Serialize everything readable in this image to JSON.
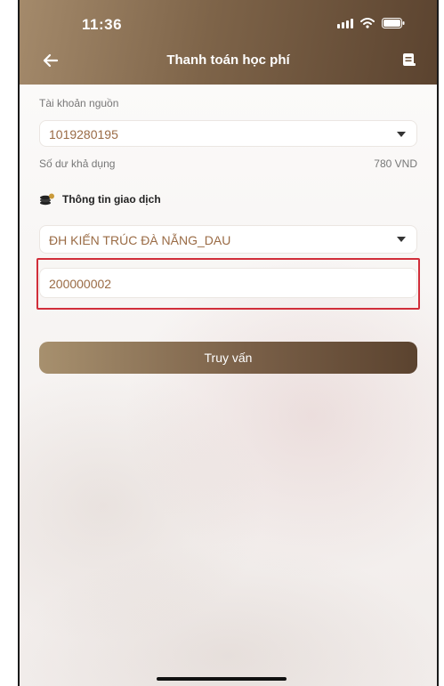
{
  "status_bar": {
    "time": "11:36",
    "signal_icon": "signal-icon",
    "wifi_icon": "wifi-icon",
    "battery_icon": "battery-icon"
  },
  "nav": {
    "title": "Thanh toán học phí",
    "back_icon": "back-arrow-icon",
    "menu_icon": "receipt-icon"
  },
  "source_account": {
    "label": "Tài khoản nguồn",
    "value": "1019280195",
    "dropdown_icon": "caret-down-icon"
  },
  "balance": {
    "label": "Số dư khả dụng",
    "value": "780 VND"
  },
  "transaction": {
    "section_title": "Thông tin giao dịch",
    "section_icon": "coins-icon",
    "school_value": "ĐH KIẾN TRÚC ĐÀ NẴNG_DAU",
    "code_value": "200000002"
  },
  "actions": {
    "query_label": "Truy vấn"
  },
  "colors": {
    "accent": "#7e6449",
    "highlight": "#d12e3a",
    "value_text": "#9a6b45"
  }
}
